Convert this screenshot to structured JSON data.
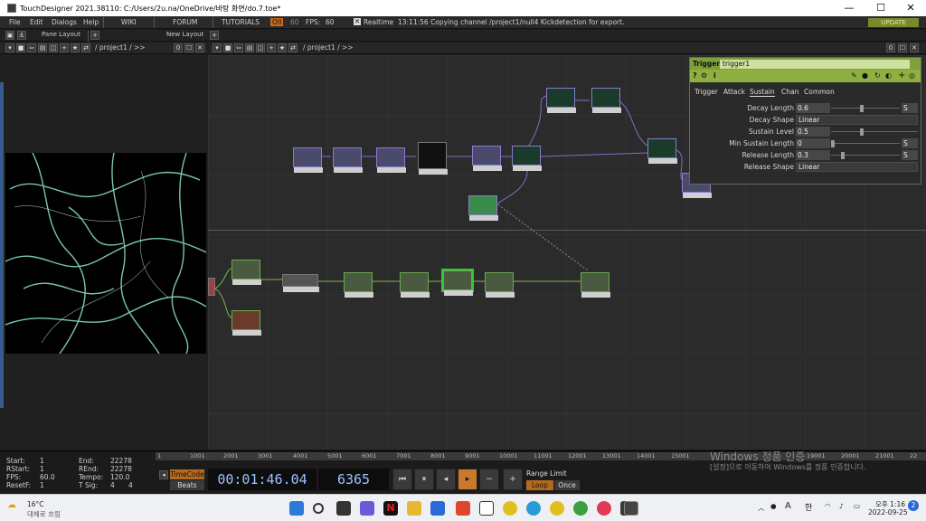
{
  "window": {
    "title": "TouchDesigner 2021.38110: C:/Users/2u.na/OneDrive/바탕 화면/do.7.toe*",
    "minimize": "—",
    "maximize": "☐",
    "close": "✕"
  },
  "menubar": {
    "items": [
      "File",
      "Edit",
      "Dialogs",
      "Help"
    ],
    "wiki": "WIKI",
    "forum": "FORUM",
    "tutorials": "TUTORIALS",
    "oii": "OII",
    "fps_target": "60",
    "fps_label": "FPS:",
    "fps_value": "60",
    "realtime": "Realtime",
    "status": "13:11:56 Copying channel /project1/null4 Kickdetection for export.",
    "update": "UPDATE"
  },
  "layoutbar": {
    "pane_layout": "Pane Layout",
    "new_layout": "New Layout",
    "add": "+"
  },
  "left_pane": {
    "path": "/ project1 / >>",
    "counter": "0"
  },
  "network_pane": {
    "path": "/ project1 / >>",
    "counter": "0"
  },
  "param_panel": {
    "type": "Trigger",
    "name": "trigger1",
    "help": "?",
    "info": "i",
    "tabs": [
      "Trigger",
      "Attack",
      "Sustain",
      "Chan",
      "Common"
    ],
    "active_tab": "Sustain",
    "params": [
      {
        "label": "Decay Length",
        "value": "0.6",
        "unit": "S",
        "slider": 0.45
      },
      {
        "label": "Decay Shape",
        "value": "Linear"
      },
      {
        "label": "Sustain Level",
        "value": "0.5",
        "slider": 0.35
      },
      {
        "label": "Min Sustain Length",
        "value": "0",
        "unit": "S",
        "slider": 0.0
      },
      {
        "label": "Release Length",
        "value": "0.3",
        "unit": "S",
        "slider": 0.15
      },
      {
        "label": "Release Shape",
        "value": "Linear"
      }
    ]
  },
  "timeline": {
    "start_label": "Start:",
    "start": "1",
    "end_label": "End:",
    "end": "22278",
    "rstart_label": "RStart:",
    "rstart": "1",
    "rend_label": "REnd:",
    "rend": "22278",
    "fps_label": "FPS:",
    "fps": "60.0",
    "tempo_label": "Tempo:",
    "tempo": "120.0",
    "resetf_label": "ResetF:",
    "resetf": "1",
    "tsig_label": "T Sig:",
    "tsig_a": "4",
    "tsig_b": "4",
    "ticks": [
      "1",
      "1001",
      "2001",
      "3001",
      "4001",
      "5001",
      "6001",
      "7001",
      "8001",
      "9001",
      "10001",
      "11001",
      "12001",
      "13001",
      "14001",
      "15001",
      "19001",
      "20001",
      "21001",
      "22"
    ],
    "timecode_btn": "TimeCode",
    "beats_btn": "Beats",
    "time_display": "00:01:46.04",
    "frame_display": "6365",
    "range_limit": "Range Limit",
    "loop": "Loop",
    "once": "Once"
  },
  "watermark": {
    "line1": "Windows 정품 인증",
    "line2": "[설정]으로 이동하여 Windows를 정품 인증합니다."
  },
  "taskbar": {
    "temp": "16°C",
    "weather": "대체로 흐림",
    "time": "오후 1:16",
    "date": "2022-09-25",
    "lang": "한",
    "ime": "A"
  }
}
